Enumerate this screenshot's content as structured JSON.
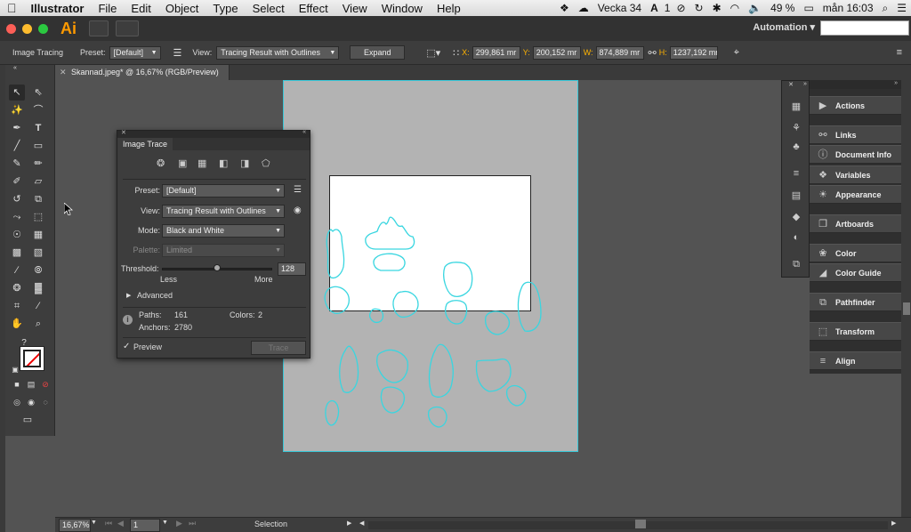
{
  "menubar": {
    "apple": "",
    "app_name": "Illustrator",
    "items": [
      "File",
      "Edit",
      "Object",
      "Type",
      "Select",
      "Effect",
      "View",
      "Window",
      "Help"
    ],
    "week": "Vecka 34",
    "battery": "49 %",
    "clock": "mån 16:03",
    "adobe_badge": "1"
  },
  "appbar": {
    "logo": "Ai",
    "workspace": "Automation"
  },
  "controlbar": {
    "panel_name": "Image Tracing",
    "preset_label": "Preset:",
    "preset_value": "[Default]",
    "view_label": "View:",
    "view_value": "Tracing Result with Outlines",
    "expand_label": "Expand",
    "x_label": "X:",
    "x_value": "299,861 mr",
    "y_label": "Y:",
    "y_value": "200,152 mr",
    "w_label": "W:",
    "w_value": "874,889 mr",
    "h_label": "H:",
    "h_value": "1237,192 mr"
  },
  "document": {
    "tab_title": "Skannad.jpeg* @ 16,67% (RGB/Preview)"
  },
  "image_trace": {
    "title": "Image Trace",
    "preset_label": "Preset:",
    "preset_value": "[Default]",
    "view_label": "View:",
    "view_value": "Tracing Result with Outlines",
    "mode_label": "Mode:",
    "mode_value": "Black and White",
    "palette_label": "Palette:",
    "palette_value": "Limited",
    "threshold_label": "Threshold:",
    "threshold_value": "128",
    "threshold_fraction": 0.5,
    "less_label": "Less",
    "more_label": "More",
    "advanced_label": "Advanced",
    "paths_label": "Paths:",
    "paths_value": "161",
    "colors_label": "Colors:",
    "colors_value": "2",
    "anchors_label": "Anchors:",
    "anchors_value": "2780",
    "preview_label": "Preview",
    "trace_label": "Trace"
  },
  "right_panels": {
    "items": [
      "Actions",
      "Links",
      "Document Info",
      "Variables",
      "Appearance",
      "Artboards",
      "Color",
      "Color Guide",
      "Pathfinder",
      "Transform",
      "Align"
    ]
  },
  "statusbar": {
    "zoom": "16,67%",
    "artboard": "1",
    "status": "Selection"
  },
  "colors": {
    "trace_outline": "#39d6e0",
    "accent_orange": "#ff9a00"
  }
}
